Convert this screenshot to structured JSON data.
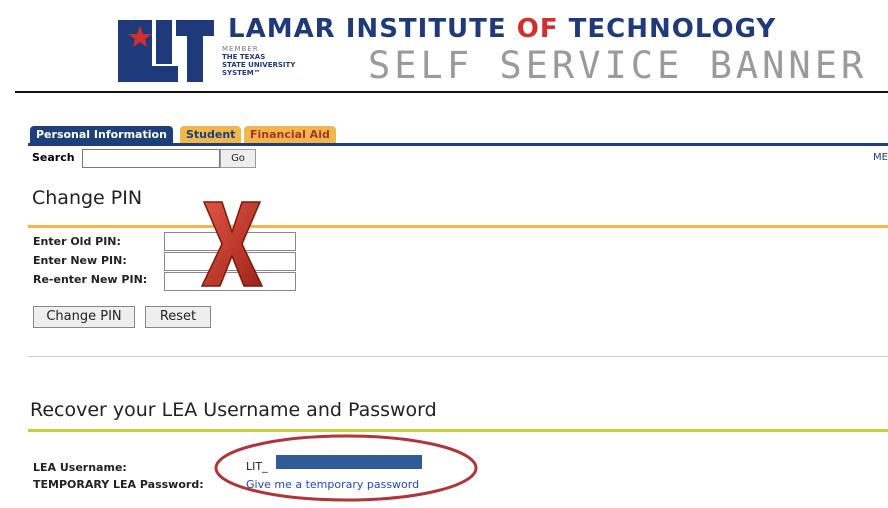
{
  "header": {
    "logo_text": "LIT",
    "institution_prefix": "LAMAR INSTITUTE ",
    "institution_of": "OF",
    "institution_suffix": " TECHNOLOGY",
    "member_line1": "MEMBER",
    "member_line2": "THE TEXAS",
    "member_line3": "STATE UNIVERSITY",
    "member_line4": "SYSTEM™",
    "subtitle": "SELF SERVICE BANNER"
  },
  "tabs": [
    {
      "label": "Personal Information"
    },
    {
      "label": "Student"
    },
    {
      "label": "Financial Aid"
    }
  ],
  "search": {
    "label": "Search",
    "value": "",
    "go_label": "Go",
    "right_link": "ME"
  },
  "change_pin": {
    "title": "Change PIN",
    "old_label": "Enter Old PIN:",
    "new_label": "Enter New PIN:",
    "reenter_label": "Re-enter New PIN:",
    "submit_label": "Change PIN",
    "reset_label": "Reset"
  },
  "recover": {
    "title": "Recover your LEA Username and Password",
    "username_label": "LEA Username:",
    "username_value": "LIT_",
    "temp_label": "TEMPORARY LEA Password:",
    "temp_link": "Give me a temporary password"
  },
  "colors": {
    "brand_blue": "#1d3f7a",
    "tab_gold": "#f2b74a",
    "accent_red": "#d32e2e",
    "annotation_red": "#c0392b",
    "redaction": "#2f5c96"
  },
  "icons": [
    "red-x-annotation-icon",
    "red-ellipse-annotation-icon"
  ]
}
